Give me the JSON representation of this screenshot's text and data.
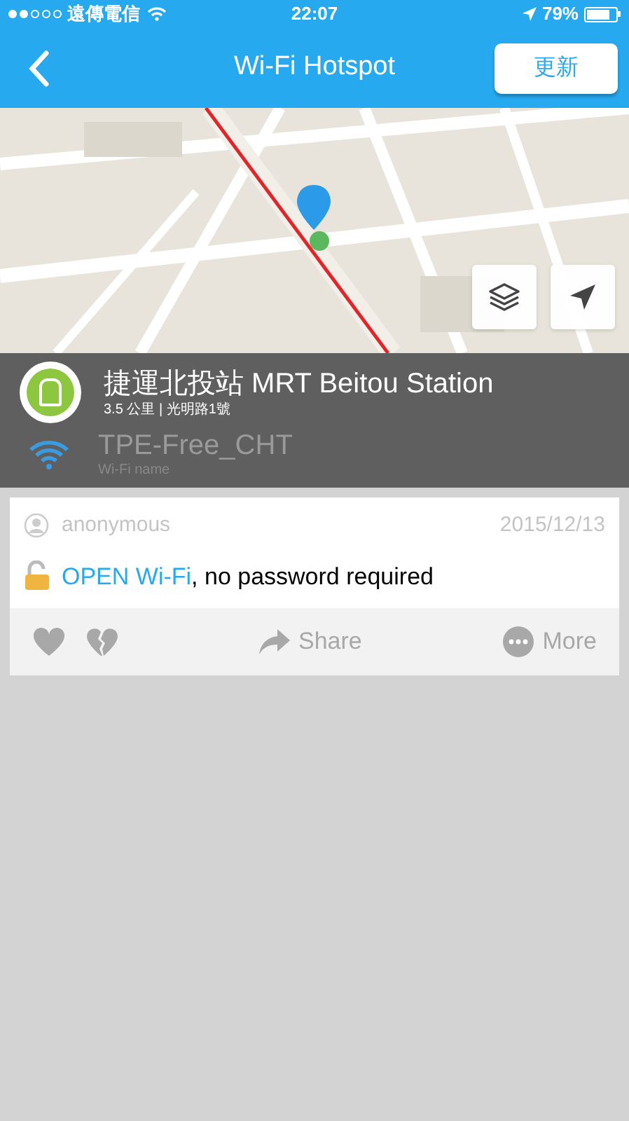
{
  "status_bar": {
    "carrier": "遠傳電信",
    "time": "22:07",
    "battery": "79%"
  },
  "nav": {
    "title": "Wi-Fi Hotspot",
    "action": "更新"
  },
  "place": {
    "name": "捷運北投站 MRT Beitou Station",
    "detail": "3.5 公里 | 光明路1號",
    "wifi_name": "TPE-Free_CHT",
    "wifi_caption": "Wi-Fi name"
  },
  "post": {
    "author": "anonymous",
    "date": "2015/12/13",
    "highlight": "OPEN Wi-Fi",
    "message": ", no password required",
    "actions": [
      {
        "kind": "like"
      },
      {
        "kind": "dislike"
      },
      {
        "kind": "share",
        "label": "Share"
      },
      {
        "kind": "more",
        "label": "More"
      }
    ]
  }
}
